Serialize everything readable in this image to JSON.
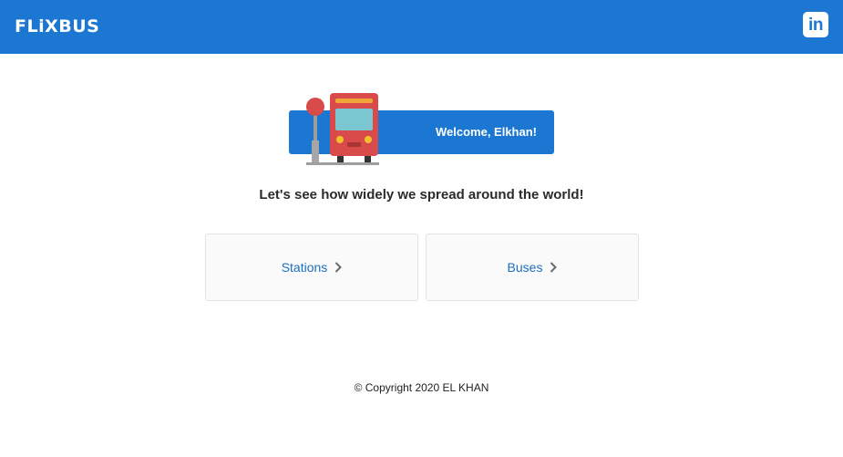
{
  "header": {
    "logo_text": "FLiXBUS",
    "linkedin_label": "in",
    "linkedin_icon": "linkedin-icon",
    "brand_color": "#1b77d2"
  },
  "hero": {
    "welcome_text": "Welcome, Elkhan!",
    "illustration_icon": "bus-stop-icon"
  },
  "tagline": "Let's see how widely we spread around the world!",
  "cards": [
    {
      "label": "Stations",
      "icon": "chevron-right-icon"
    },
    {
      "label": "Buses",
      "icon": "chevron-right-icon"
    }
  ],
  "footer": {
    "copyright": "© Copyright 2020 EL KHAN"
  }
}
